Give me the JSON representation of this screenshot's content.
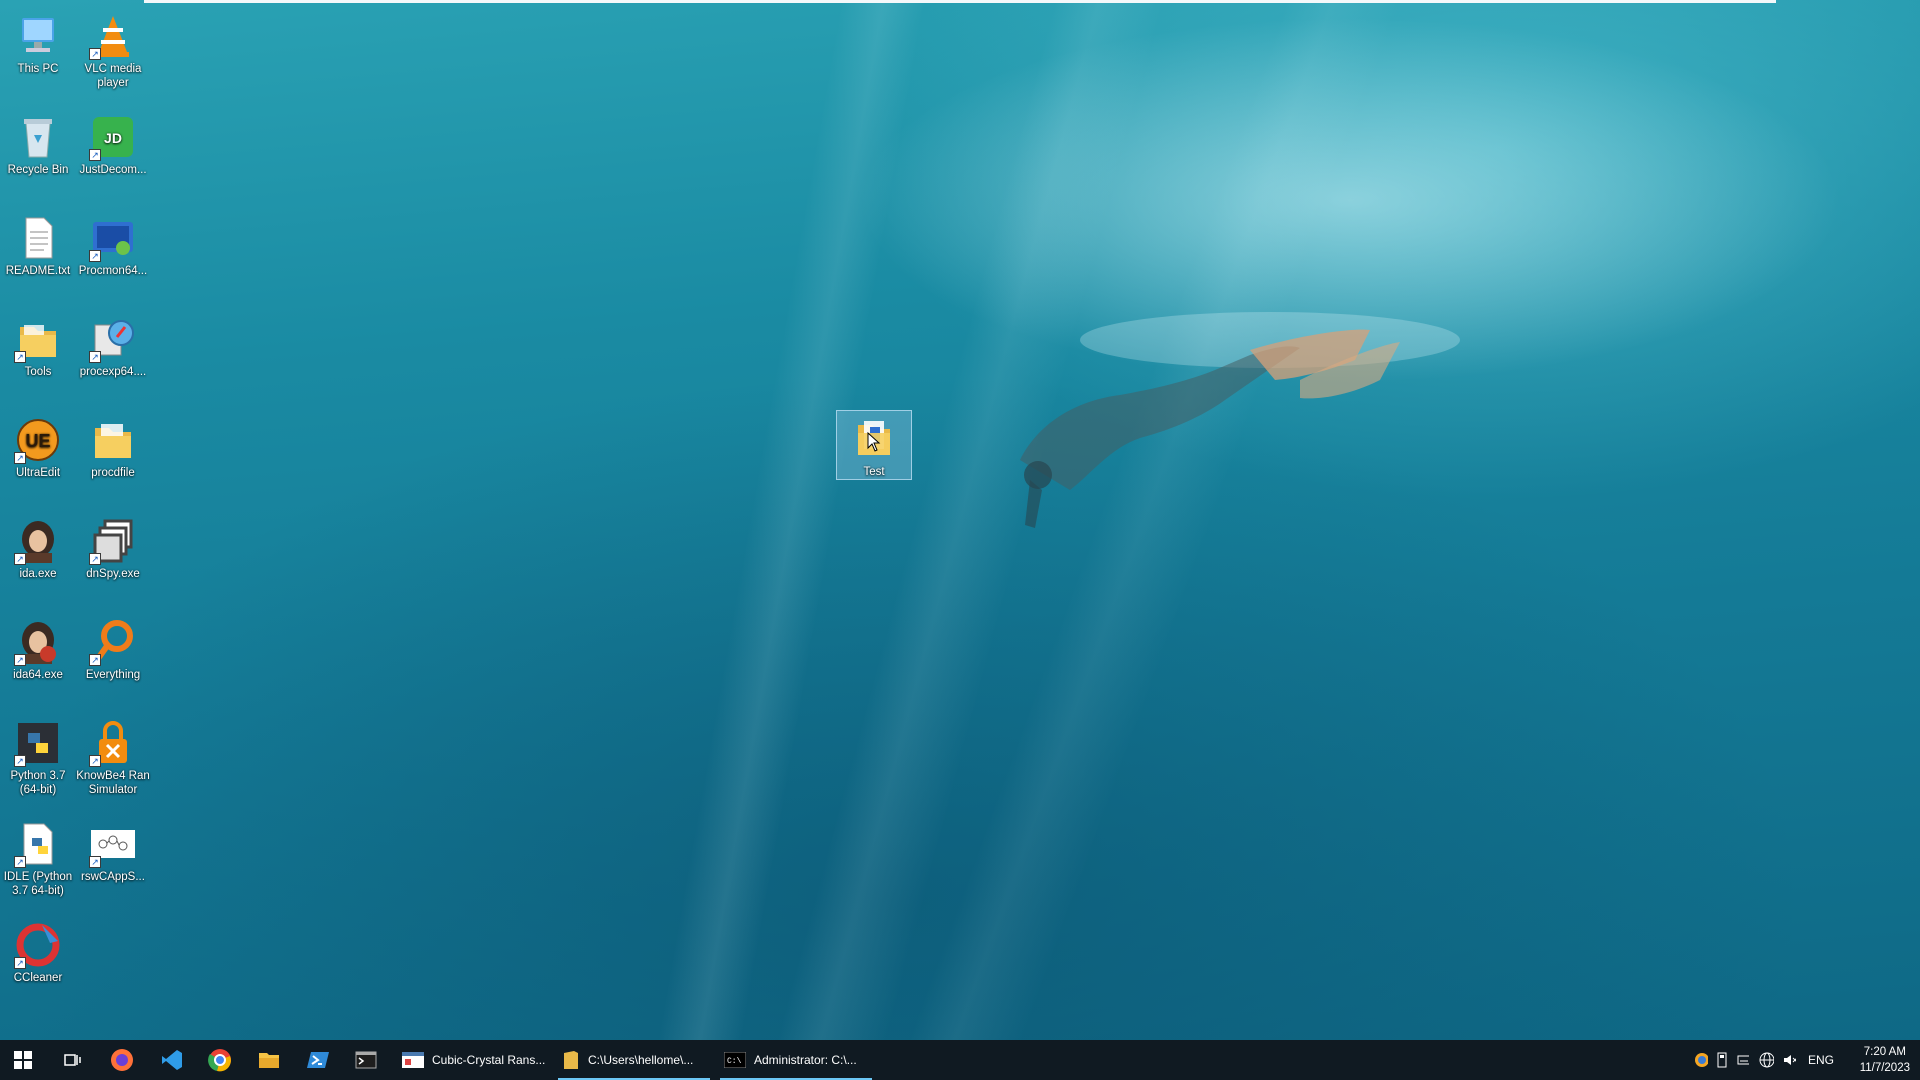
{
  "desktop": {
    "icons": [
      {
        "label": "This PC",
        "icon": "this-pc-icon"
      },
      {
        "label": "VLC media player",
        "icon": "vlc-icon"
      },
      {
        "label": "Recycle Bin",
        "icon": "recycle-bin-icon"
      },
      {
        "label": "JustDecom...",
        "icon": "justdecompile-icon"
      },
      {
        "label": "README.txt",
        "icon": "text-file-icon"
      },
      {
        "label": "Procmon64...",
        "icon": "procmon-icon"
      },
      {
        "label": "Tools",
        "icon": "folder-icon"
      },
      {
        "label": "procexp64....",
        "icon": "procexp-icon"
      },
      {
        "label": "UltraEdit",
        "icon": "ultraedit-icon"
      },
      {
        "label": "procdfile",
        "icon": "folder-icon"
      },
      {
        "label": "ida.exe",
        "icon": "ida-icon"
      },
      {
        "label": "dnSpy.exe",
        "icon": "dnspy-icon"
      },
      {
        "label": "ida64.exe",
        "icon": "ida64-icon"
      },
      {
        "label": "Everything",
        "icon": "everything-icon"
      },
      {
        "label": "Python 3.7 (64-bit)",
        "icon": "python-icon"
      },
      {
        "label": "KnowBe4 Ran Simulator",
        "icon": "knowbe4-icon"
      },
      {
        "label": "IDLE (Python 3.7 64-bit)",
        "icon": "idle-icon"
      },
      {
        "label": "rswCAppS...",
        "icon": "rswcapps-icon"
      },
      {
        "label": "CCleaner",
        "icon": "ccleaner-icon"
      }
    ],
    "selected_icon": {
      "label": "Test",
      "icon": "folder-icon"
    },
    "jd_text": "JD",
    "ue_text": "UE"
  },
  "taskbar": {
    "pinned": [
      "start-icon",
      "task-view-icon",
      "firefox-icon",
      "vscode-icon",
      "chrome-icon",
      "file-explorer-icon",
      "powershell-icon",
      "terminal-icon"
    ],
    "open_apps": [
      {
        "label": "Cubic-Crystal Rans...",
        "icon": "app-window-icon"
      },
      {
        "label": "C:\\Users\\hellome\\...",
        "icon": "folder-icon"
      },
      {
        "label": "Administrator: C:\\...",
        "icon": "cmd-icon"
      }
    ],
    "tray": {
      "language": "ENG",
      "time": "7:20 AM",
      "date": "11/7/2023"
    }
  },
  "colors": {
    "taskbar": "#101a22",
    "accent_underline": "#6cc7f5",
    "water": "#1a8ba3"
  }
}
